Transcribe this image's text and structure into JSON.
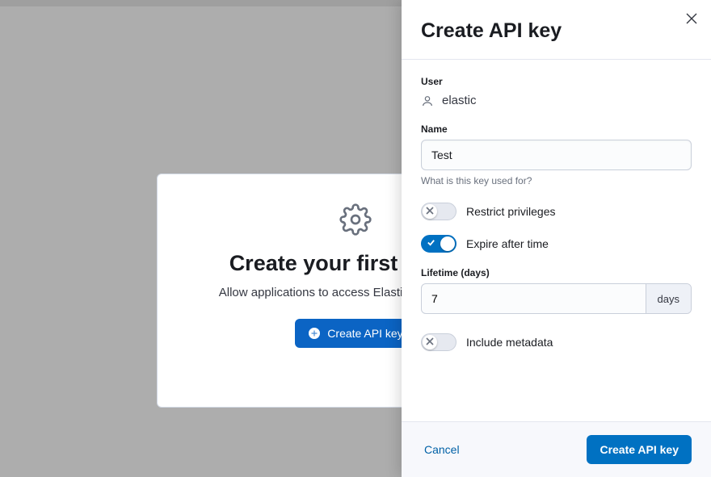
{
  "empty_state": {
    "title": "Create your first API key",
    "subtitle": "Allow applications to access Elastic on your behalf.",
    "button_label": "Create API key"
  },
  "flyout": {
    "title": "Create API key",
    "user": {
      "label": "User",
      "value": "elastic"
    },
    "name": {
      "label": "Name",
      "value": "Test",
      "help": "What is this key used for?"
    },
    "toggles": {
      "restrict": {
        "label": "Restrict privileges",
        "on": false
      },
      "expire": {
        "label": "Expire after time",
        "on": true
      },
      "metadata": {
        "label": "Include metadata",
        "on": false
      }
    },
    "lifetime": {
      "label": "Lifetime (days)",
      "value": "7",
      "unit": "days"
    },
    "footer": {
      "cancel": "Cancel",
      "submit": "Create API key"
    }
  }
}
